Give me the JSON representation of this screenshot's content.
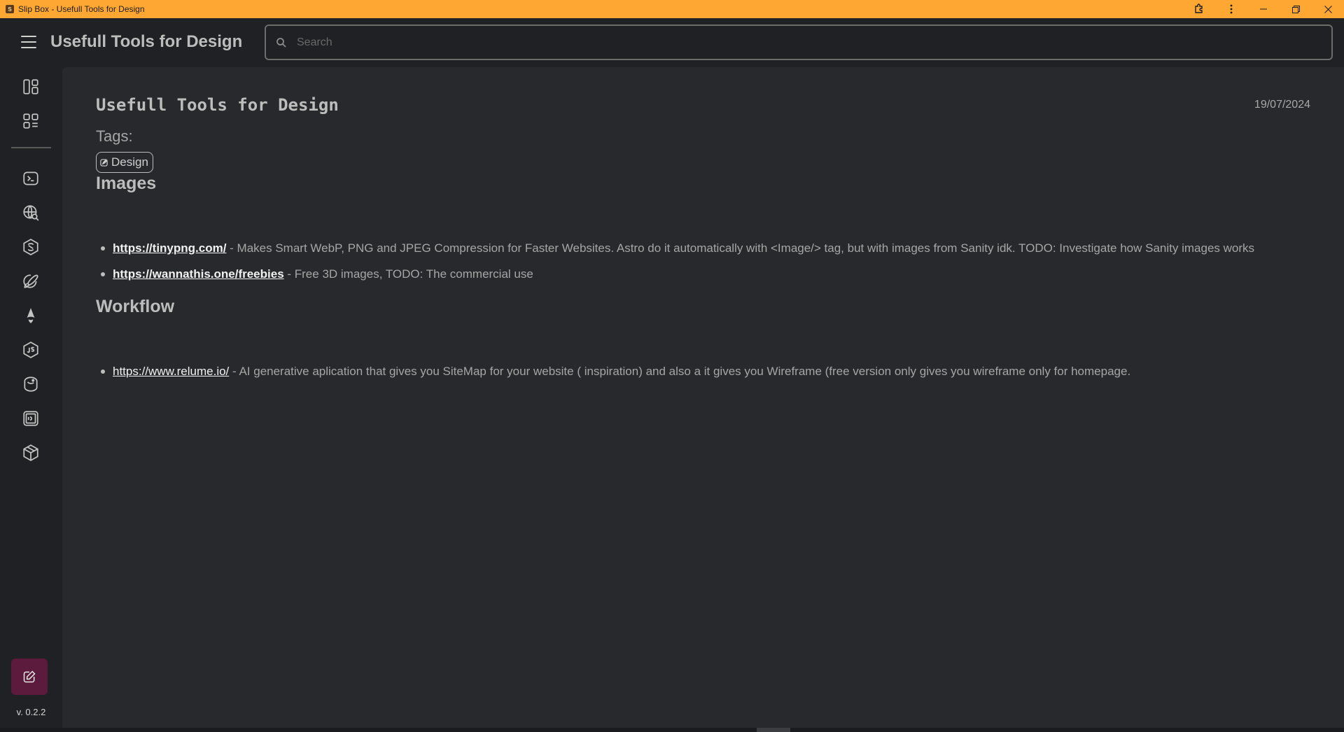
{
  "window": {
    "title": "Slip Box - Usefull Tools for Design",
    "app_icon_letter": "S"
  },
  "header": {
    "title": "Usefull Tools for Design",
    "search_placeholder": "Search"
  },
  "sidebar": {
    "version": "v. 0.2.2",
    "icons": [
      "dashboard-icon",
      "grid-list-icon",
      "terminal-icon",
      "web-search-icon",
      "sanity-icon",
      "design-pen-icon",
      "astro-icon",
      "javascript-icon",
      "database-icon",
      "code-box-icon",
      "package-icon"
    ]
  },
  "note": {
    "title": "Usefull Tools for Design",
    "date": "19/07/2024",
    "tags_label": "Tags:",
    "tags": [
      "Design"
    ],
    "sections": [
      {
        "heading": "Images",
        "items": [
          {
            "link": "https://tinypng.com/",
            "text": " - Makes Smart WebP, PNG and JPEG Compression for Faster Websites. Astro do it automatically with <Image/> tag, but with images from Sanity idk. TODO: Investigate how Sanity images works"
          },
          {
            "link": "https://wannathis.one/freebies",
            "text": " - Free 3D images, TODO: The commercial use"
          }
        ]
      },
      {
        "heading": "Workflow",
        "items": [
          {
            "link": "https://www.relume.io/",
            "text": " - AI generative aplication that gives you SiteMap for your website ( inspiration) and also a it gives you Wireframe (free version only gives you wireframe only for homepage."
          }
        ]
      }
    ]
  },
  "colors": {
    "titlebar": "#ffa733",
    "background": "#202124",
    "panel": "#28292d",
    "edit_button": "#5c1a3c"
  }
}
